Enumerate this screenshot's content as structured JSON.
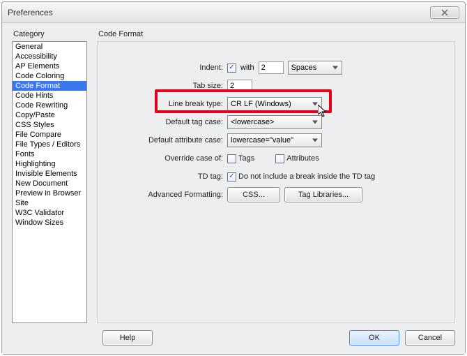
{
  "window": {
    "title": "Preferences"
  },
  "category": {
    "label": "Category",
    "items": [
      "General",
      "Accessibility",
      "AP Elements",
      "Code Coloring",
      "Code Format",
      "Code Hints",
      "Code Rewriting",
      "Copy/Paste",
      "CSS Styles",
      "File Compare",
      "File Types / Editors",
      "Fonts",
      "Highlighting",
      "Invisible Elements",
      "New Document",
      "Preview in Browser",
      "Site",
      "W3C Validator",
      "Window Sizes"
    ],
    "selected_index": 4
  },
  "panel": {
    "title": "Code Format",
    "indent": {
      "label": "Indent:",
      "checked": true,
      "with_label": "with",
      "value": "2",
      "unit": "Spaces"
    },
    "tab_size": {
      "label": "Tab size:",
      "value": "2"
    },
    "line_break": {
      "label": "Line break type:",
      "value": "CR LF (Windows)"
    },
    "default_tag_case": {
      "label": "Default tag case:",
      "value": "<lowercase>"
    },
    "default_attr_case": {
      "label": "Default attribute case:",
      "value": "lowercase=\"value\""
    },
    "override": {
      "label": "Override case of:",
      "tags_label": "Tags",
      "attrs_label": "Attributes",
      "tags_checked": false,
      "attrs_checked": false
    },
    "td_tag": {
      "label": "TD tag:",
      "checkbox_label": "Do not include a break inside the TD tag",
      "checked": true
    },
    "advanced": {
      "label": "Advanced Formatting:",
      "css_btn": "CSS...",
      "taglib_btn": "Tag Libraries..."
    }
  },
  "buttons": {
    "help": "Help",
    "ok": "OK",
    "cancel": "Cancel"
  }
}
